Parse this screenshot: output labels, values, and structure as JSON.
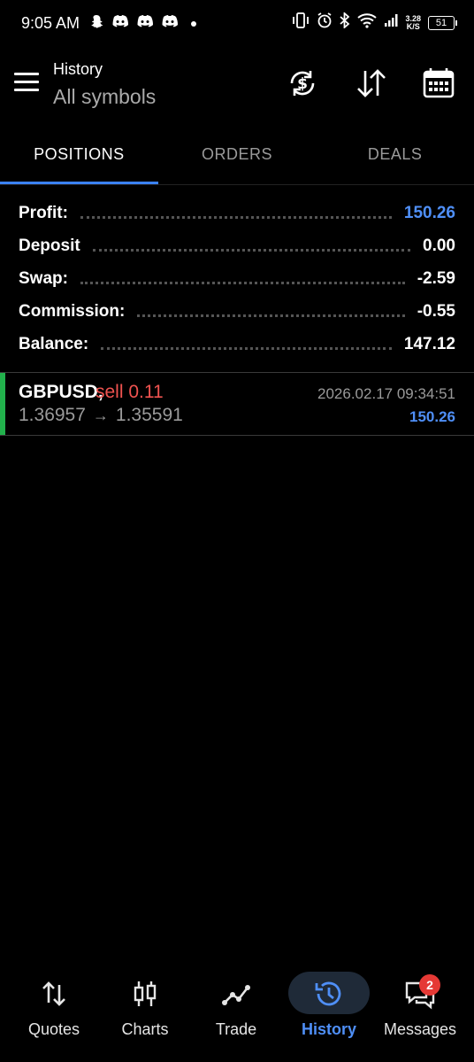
{
  "status_bar": {
    "time": "9:05 AM",
    "net_speed_value": "3.28",
    "net_speed_unit": "K/S",
    "battery": "51"
  },
  "header": {
    "title": "History",
    "subtitle": "All symbols"
  },
  "tabs": [
    {
      "label": "POSITIONS",
      "active": true
    },
    {
      "label": "ORDERS",
      "active": false
    },
    {
      "label": "DEALS",
      "active": false
    }
  ],
  "summary": [
    {
      "label": "Profit:",
      "value": "150.26"
    },
    {
      "label": "Deposit",
      "value": "0.00"
    },
    {
      "label": "Swap:",
      "value": "-2.59"
    },
    {
      "label": "Commission:",
      "value": "-0.55"
    },
    {
      "label": "Balance:",
      "value": "147.12"
    }
  ],
  "position": {
    "symbol": "GBPUSD,",
    "side": "sell 0.11",
    "open_price": "1.36957",
    "close_price": "1.35591",
    "time": "2026.02.17 09:34:51",
    "profit": "150.26"
  },
  "bottom_nav": [
    {
      "label": "Quotes",
      "icon": "quotes-icon"
    },
    {
      "label": "Charts",
      "icon": "candles-icon"
    },
    {
      "label": "Trade",
      "icon": "trade-icon"
    },
    {
      "label": "History",
      "icon": "history-icon",
      "active": true
    },
    {
      "label": "Messages",
      "icon": "messages-icon",
      "badge": "2"
    }
  ],
  "colors": {
    "accent_blue": "#4f8ff7",
    "sell_red": "#ef5350",
    "position_bar_green": "#22b14c"
  }
}
